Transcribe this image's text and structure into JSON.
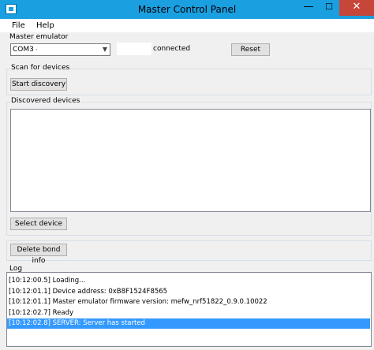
{
  "window": {
    "title": "Master Control Panel",
    "minimize_glyph": "—",
    "maximize_glyph": "☐",
    "close_glyph": "✕",
    "accent": "#1a9fe0"
  },
  "menu": {
    "file": "File",
    "help": "Help"
  },
  "master": {
    "group_label": "Master emulator",
    "port_value": "COM3 -",
    "status": "connected",
    "reset_label": "Reset"
  },
  "scan": {
    "group_label": "Scan for devices",
    "start_label": "Start discovery"
  },
  "discovered": {
    "group_label": "Discovered devices",
    "select_label": "Select device"
  },
  "bond": {
    "delete_label": "Delete bond info"
  },
  "log": {
    "group_label": "Log",
    "lines": [
      "[10:12:00.5] Loading...",
      "[10:12:01.1] Device address: 0xB8F1524F8565",
      "[10:12:01.1] Master emulator firmware version: mefw_nrf51822_0.9.0.10022",
      "[10:12:02.7] Ready",
      "[10:12:02.8] SERVER: Server has started"
    ],
    "selected_index": 4
  }
}
